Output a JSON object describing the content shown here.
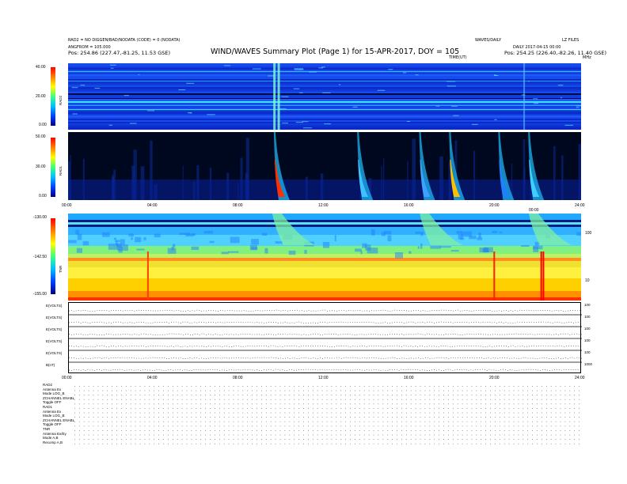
{
  "header": {
    "title": "WIND/WAVES Summary Plot (Page 1) for 15-APR-2017, DOY = 105",
    "left_line1": "RAD2 = NO DIGGEN/BAD/NODATA (CODE) = 0 (NODATA)",
    "left_line2": "ANGFROM = 105.000",
    "left_line3": "Pos:  254.86 (227.47,-81.25, 11.53 GSE)",
    "right_line1": "WAVES/DAILY",
    "right_line2": "LZ FILES",
    "right_line3": "DAILY 2017-04-15 00:00",
    "right_line4": "Pos:  254.25 (226.40,-82.26, 11.40 GSE)",
    "time_unit": "TIME(UT)",
    "mhz": "MHz"
  },
  "panels": {
    "rad2": {
      "label": "RAD2",
      "ticks": [
        "40.00",
        "20.00",
        "0.00"
      ]
    },
    "rad1": {
      "label": "RAD1",
      "ticks": [
        "50.00",
        "30.00",
        "0.00"
      ]
    },
    "tnr": {
      "label": "TNR",
      "ticks": [
        "-130.00",
        "-142.50",
        "-155.00"
      ],
      "right_ticks": [
        "100",
        "10"
      ]
    },
    "axis_times": [
      "00:00",
      "04:00",
      "08:00",
      "12:00",
      "16:00",
      "20:00",
      "24:00"
    ],
    "mark_label": "00:00"
  },
  "stack_rows": [
    {
      "label": "E(VOLTS)",
      "right": "100"
    },
    {
      "label": "E(VOLTS)",
      "right": "100"
    },
    {
      "label": "E(VOLTS)",
      "right": "100"
    },
    {
      "label": "E(VOLTS)",
      "right": "100"
    },
    {
      "label": "E(VOLTS)",
      "right": "100"
    },
    {
      "label": "B(nT)",
      "right": "1000"
    }
  ],
  "bottom_axis": [
    "00:00",
    "04:00",
    "08:00",
    "12:00",
    "16:00",
    "20:00",
    "24:00"
  ],
  "info_block": [
    "RAD2",
    "Antenna   Ex",
    "Mode    LOG_B",
    "ZCHANNEL ENABL",
    "Toggle    OFF",
    "RAD1",
    "Antenna   Ex",
    "Mode   LOG_B",
    "ZCHANNEL ENABL",
    "Toggle    OFF",
    "TNR",
    "Antenna  Ex/Ey",
    "Mode    A,B",
    "Recomp   A,B"
  ],
  "chart_data": {
    "type": "heatmap",
    "title": "WIND/WAVES Summary Plot (Page 1) for 15-APR-2017, DOY = 105",
    "xlabel": "TIME(UT)",
    "xlim": [
      0,
      24
    ],
    "panels": [
      {
        "name": "RAD2",
        "ylim": [
          0,
          40
        ],
        "colorbar": [
          "0.00",
          "20.00",
          "40.00"
        ]
      },
      {
        "name": "RAD1",
        "ylim": [
          0,
          50
        ],
        "colorbar": [
          "0.00",
          "30.00",
          "50.00"
        ]
      },
      {
        "name": "TNR",
        "ylim": [
          -155,
          -130
        ],
        "colorbar": [
          "-155.00",
          "-142.50",
          "-130.00"
        ]
      }
    ],
    "events_hours": [
      9.6,
      9.8,
      13.5,
      16.4,
      17.9,
      19.8,
      21.1,
      21.4,
      22.0
    ]
  }
}
